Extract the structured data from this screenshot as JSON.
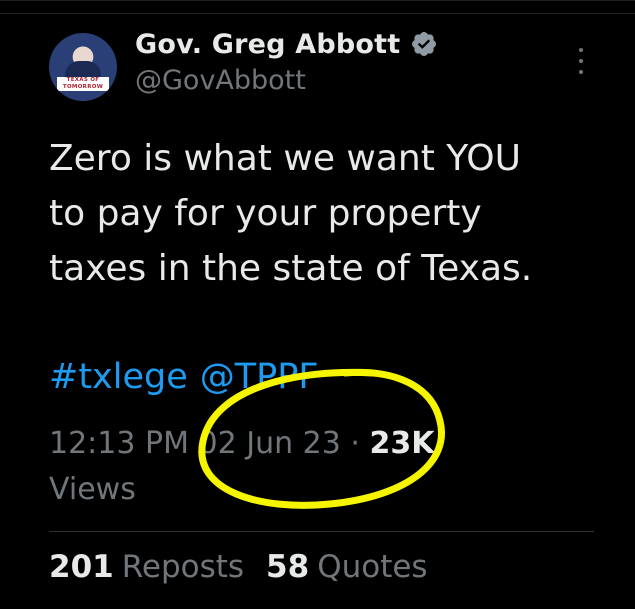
{
  "user": {
    "display_name": "Gov. Greg Abbott",
    "handle": "@GovAbbott",
    "avatar_banner_line1": "TEXAS OF",
    "avatar_banner_line2": "TOMORROW",
    "verified_color": "#1d9bf0"
  },
  "tweet": {
    "text": "Zero is what we want YOU\nto pay for your property\ntaxes in the state of Texas.",
    "hashtag": "#txlege",
    "mention": "@TPPF"
  },
  "meta": {
    "time": "12:13 PM",
    "date": "02 Jun 23",
    "separator": "·",
    "views_count": "23K",
    "views_label": "Views"
  },
  "stats": {
    "reposts_count": "201",
    "reposts_label": "Reposts",
    "quotes_count": "58",
    "quotes_label": "Quotes"
  },
  "annotation": {
    "color": "#f5f500"
  },
  "icons": {
    "more": "more-vertical-icon",
    "verified": "verified-badge-icon"
  }
}
